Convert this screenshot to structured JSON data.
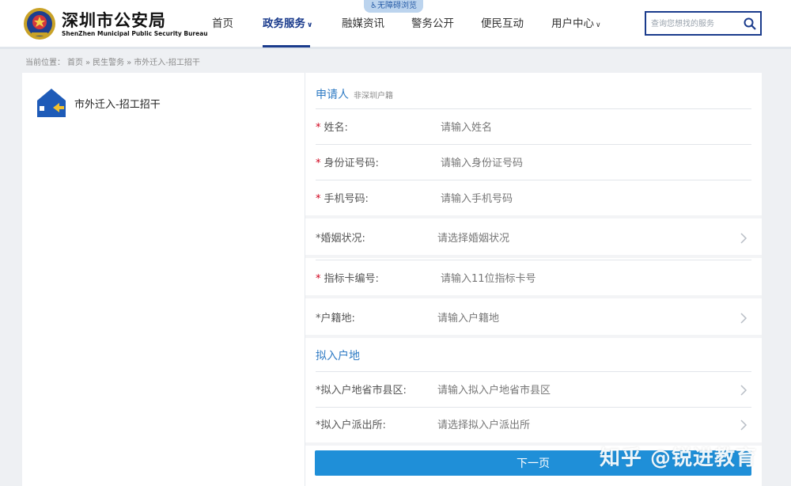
{
  "header": {
    "title": "深圳市公安局",
    "subtitle": "ShenZhen Municipal Public Security Bureau",
    "a11y_label": "无障碍浏览",
    "nav": [
      {
        "label": "首页"
      },
      {
        "label": "政务服务",
        "caret": "∨"
      },
      {
        "label": "融媒资讯"
      },
      {
        "label": "警务公开"
      },
      {
        "label": "便民互动"
      },
      {
        "label": "用户中心",
        "caret": "∨"
      }
    ],
    "search_placeholder": "查询您想找的服务"
  },
  "breadcrumb": {
    "prefix": "当前位置：",
    "items": [
      "首页",
      "»",
      "民生警务",
      "»",
      "市外迁入-招工招干"
    ]
  },
  "service": {
    "name": "市外迁入-招工招干"
  },
  "form": {
    "applicant_title": "申请人",
    "applicant_sub": "非深圳户籍",
    "required_mark": "*",
    "name_label": "姓名:",
    "name_placeholder": "请输入姓名",
    "id_label": "身份证号码:",
    "id_placeholder": "请输入身份证号码",
    "phone_label": "手机号码:",
    "phone_placeholder": "请输入手机号码",
    "marital_label": "*婚姻状况:",
    "marital_placeholder": "请选择婚姻状况",
    "card_label": "指标卡编号:",
    "card_placeholder": "请输入11位指标卡号",
    "household_label": "*户籍地:",
    "household_placeholder": "请输入户籍地",
    "target_title": "拟入户地",
    "region_label": "*拟入户地省市县区:",
    "region_placeholder": "请输入拟入户地省市县区",
    "station_label": "*拟入户派出所:",
    "station_placeholder": "请选择拟入户派出所",
    "next_button": "下一页"
  },
  "watermark": "知乎 @锐进教育",
  "colors": {
    "brand": "#1a3b8c",
    "accent": "#2f7bc4",
    "button": "#1f8fd8",
    "required": "#d0021b"
  }
}
